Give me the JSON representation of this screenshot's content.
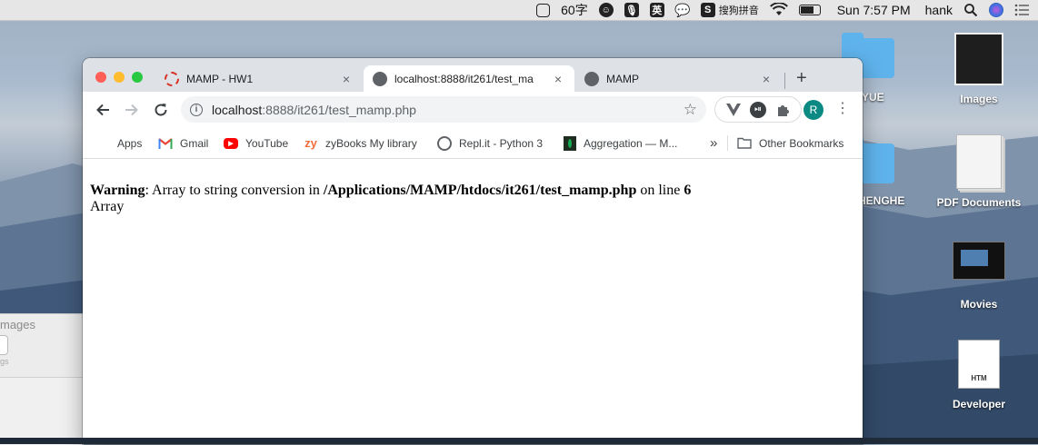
{
  "menubar": {
    "word_count": "60字",
    "ime_label": "英",
    "sogou_label": "搜狗拼音",
    "clock": "Sun 7:57 PM",
    "user": "hank"
  },
  "desktop": {
    "icons": [
      {
        "label": "YUE"
      },
      {
        "label": "Images"
      },
      {
        "label": "HENGHE"
      },
      {
        "label": "PDF Documents"
      },
      {
        "label": "Movies"
      },
      {
        "label": "Developer"
      },
      {
        "label": "HTM"
      }
    ],
    "bg_window": {
      "title": "mages",
      "sub": "gs"
    }
  },
  "browser": {
    "tabs": [
      {
        "title": "MAMP - HW1",
        "close": "×"
      },
      {
        "title": "localhost:8888/it261/test_ma",
        "close": "×"
      },
      {
        "title": "MAMP",
        "close": "×"
      }
    ],
    "new_tab": "+",
    "omnibox": {
      "host": "localhost",
      "rest": ":8888/it261/test_mamp.php"
    },
    "profile_initial": "R",
    "bookmarks": [
      {
        "label": "Apps"
      },
      {
        "label": "Gmail"
      },
      {
        "label": "YouTube"
      },
      {
        "label": "zyBooks My library",
        "icon_text": "zy"
      },
      {
        "label": "Repl.it - Python 3"
      },
      {
        "label": "Aggregation — M..."
      },
      {
        "label": "Other Bookmarks"
      }
    ],
    "bookmarks_overflow": "»"
  },
  "page": {
    "warning_label": "Warning",
    "warning_text": ": Array to string conversion in ",
    "path": "/Applications/MAMP/htdocs/it261/test_mamp.php",
    "on_line": " on line ",
    "line_no": "6",
    "output": "Array"
  },
  "colors": {
    "tab_strip": "#dee1e6",
    "profile": "#0b8a84",
    "close_red": "#ff5f57",
    "minimize_yellow": "#febc2e",
    "zoom_green": "#28c840"
  }
}
